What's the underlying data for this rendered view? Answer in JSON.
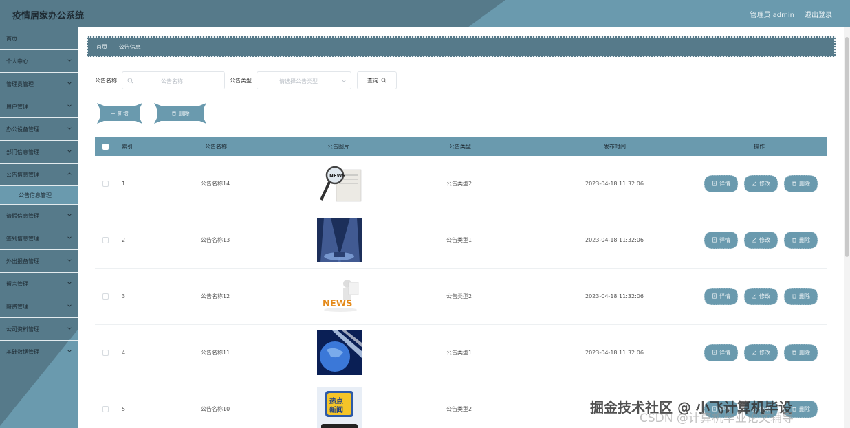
{
  "header": {
    "title": "疫情居家办公系统",
    "user": "管理员 admin",
    "logout": "退出登录"
  },
  "sidebar": {
    "items": [
      {
        "label": "首页",
        "has_children": false
      },
      {
        "label": "个人中心",
        "has_children": true
      },
      {
        "label": "管理员管理",
        "has_children": true
      },
      {
        "label": "用户管理",
        "has_children": true
      },
      {
        "label": "办公设备管理",
        "has_children": true
      },
      {
        "label": "部门信息管理",
        "has_children": true
      },
      {
        "label": "公告信息管理",
        "has_children": true,
        "expanded": true
      },
      {
        "label": "请假信息管理",
        "has_children": true
      },
      {
        "label": "签到信息管理",
        "has_children": true
      },
      {
        "label": "外出报备管理",
        "has_children": true
      },
      {
        "label": "留言管理",
        "has_children": true
      },
      {
        "label": "薪资管理",
        "has_children": true
      },
      {
        "label": "公司资料管理",
        "has_children": true
      },
      {
        "label": "基础数据管理",
        "has_children": true
      }
    ],
    "sub_item": "公告信息管理"
  },
  "breadcrumb": {
    "home": "首页",
    "current": "公告信息"
  },
  "search": {
    "name_label": "公告名称",
    "name_placeholder": "公告名称",
    "type_label": "公告类型",
    "type_placeholder": "请选择公告类型",
    "query_button": "查询"
  },
  "actions": {
    "add": "新增",
    "delete": "删除"
  },
  "table": {
    "headers": [
      "索引",
      "公告名称",
      "公告图片",
      "公告类型",
      "发布时间",
      "操作"
    ],
    "rows": [
      {
        "index": "1",
        "name": "公告名称14",
        "image": "news-magnifier",
        "type": "公告类型2",
        "time": "2023-04-18 11:32:06"
      },
      {
        "index": "2",
        "name": "公告名称13",
        "image": "spotlight-stage",
        "type": "公告类型1",
        "time": "2023-04-18 11:32:06"
      },
      {
        "index": "3",
        "name": "公告名称12",
        "image": "news-figure",
        "type": "公告类型2",
        "time": "2023-04-18 11:32:06"
      },
      {
        "index": "4",
        "name": "公告名称11",
        "image": "globe-blue",
        "type": "公告类型1",
        "time": "2023-04-18 11:32:06"
      },
      {
        "index": "5",
        "name": "公告名称10",
        "image": "hot-news-badge",
        "type": "公告类型2",
        "time": ""
      }
    ],
    "op_detail": "详情",
    "op_edit": "修改",
    "op_delete": "删除"
  },
  "watermark": {
    "line1": "掘金技术社区 @ 小飞计算机毕设",
    "line2": "CSDN @计算机毕业论文辅导"
  },
  "colors": {
    "primary": "#6a9aae",
    "dark": "#567a8a"
  }
}
